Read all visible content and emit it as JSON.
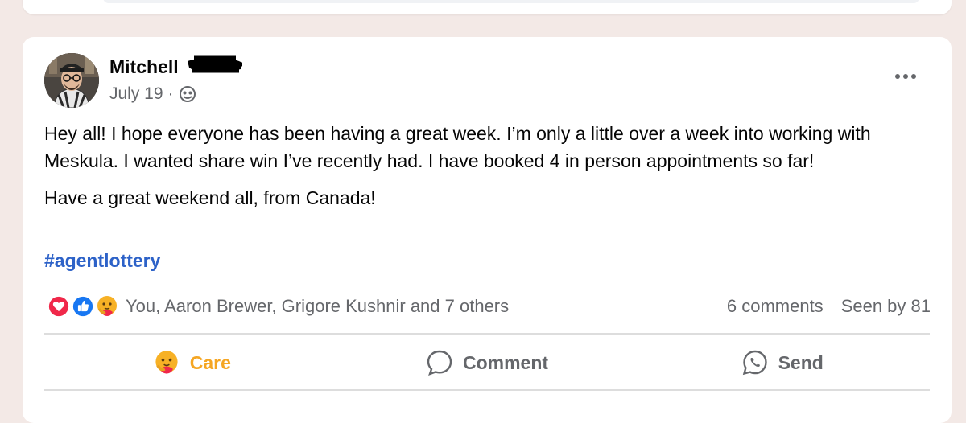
{
  "post": {
    "author": "Mitchell",
    "date": "July 19",
    "date_sep": "·",
    "privacy_icon": "globe-icon",
    "paragraphs": [
      "Hey all! I hope everyone has been having a great week. I’m only a little over a week into working with Meskula. I wanted share win I’ve recently had. I have booked 4 in person appointments so far!",
      "Have a great weekend all, from Canada!"
    ],
    "hashtag": "#agentlottery"
  },
  "reactions": {
    "icons": [
      "love-icon",
      "like-icon",
      "care-icon"
    ],
    "names": "You, Aaron Brewer, Grigore Kushnir and 7 others",
    "comments": "6 comments",
    "seen": "Seen by 81"
  },
  "actions": {
    "care": "Care",
    "comment": "Comment",
    "send": "Send"
  },
  "colors": {
    "background": "#f3e9e6",
    "hashtag": "#2d62c8",
    "care": "#f5a623",
    "love": "#f0284a",
    "like": "#1877f2",
    "secondary_text": "#65676b"
  }
}
